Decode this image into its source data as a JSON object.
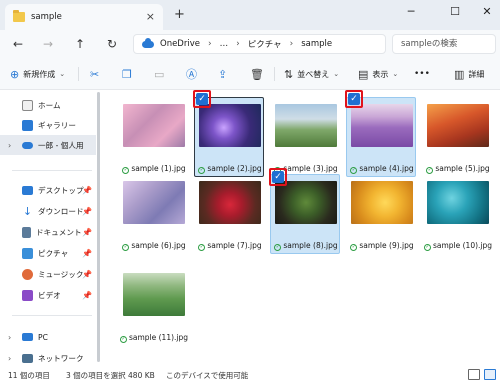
{
  "window": {
    "tab_title": "sample",
    "tab_close": "×",
    "tab_add": "+",
    "minimize": "─",
    "maximize": "☐",
    "close": "✕"
  },
  "nav": {
    "back": "←",
    "forward": "→",
    "up": "↑",
    "refresh": "↻",
    "breadcrumbs": [
      "OneDrive",
      "…",
      "ピクチャ",
      "sample"
    ],
    "separator": "›",
    "search_placeholder": "sampleの検索"
  },
  "toolbar": {
    "new_label": "新規作成",
    "sort_label": "並べ替え",
    "view_label": "表示",
    "more": "•••",
    "details_label": "詳細"
  },
  "sidebar": {
    "items": [
      {
        "label": "ホーム",
        "icon": "home-icon"
      },
      {
        "label": "ギャラリー",
        "icon": "gallery-icon"
      },
      {
        "label": "一郎 - 個人用",
        "icon": "onedrive-icon"
      },
      {
        "label": "デスクトップ",
        "icon": "desktop-icon"
      },
      {
        "label": "ダウンロード",
        "icon": "download-icon"
      },
      {
        "label": "ドキュメント",
        "icon": "documents-icon"
      },
      {
        "label": "ピクチャ",
        "icon": "pictures-icon"
      },
      {
        "label": "ミュージック",
        "icon": "music-icon"
      },
      {
        "label": "ビデオ",
        "icon": "video-icon"
      },
      {
        "label": "PC",
        "icon": "pc-icon"
      },
      {
        "label": "ネットワーク",
        "icon": "network-icon"
      }
    ]
  },
  "files": [
    {
      "name": "sample (1).jpg",
      "selected": false
    },
    {
      "name": "sample (2).jpg",
      "selected": true
    },
    {
      "name": "sample (3).jpg",
      "selected": false
    },
    {
      "name": "sample (4).jpg",
      "selected": true
    },
    {
      "name": "sample (5).jpg",
      "selected": false
    },
    {
      "name": "sample (6).jpg",
      "selected": false
    },
    {
      "name": "sample (7).jpg",
      "selected": false
    },
    {
      "name": "sample (8).jpg",
      "selected": true
    },
    {
      "name": "sample (9).jpg",
      "selected": false
    },
    {
      "name": "sample (10).jpg",
      "selected": false
    },
    {
      "name": "sample (11).jpg",
      "selected": false
    }
  ],
  "status": {
    "item_count": "11 個の項目",
    "selection": "3 個の項目を選択  480 KB",
    "availability": "このデバイスで使用可能"
  },
  "colors": {
    "accent": "#1f6fd1",
    "selection_bg": "#cce4f7",
    "highlight_ring": "#e0131b",
    "sync_ok": "#2e9e44"
  }
}
